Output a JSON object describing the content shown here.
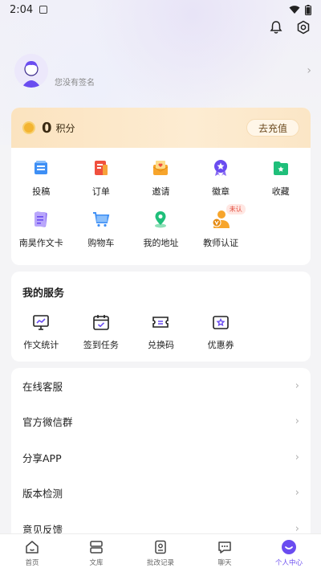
{
  "status_bar": {
    "time": "2:04"
  },
  "profile": {
    "signature": "您没有签名"
  },
  "points": {
    "value": "0",
    "label": "积分",
    "recharge_label": "去充值"
  },
  "features": [
    {
      "label": "投稿",
      "icon": "document-stack-icon"
    },
    {
      "label": "订单",
      "icon": "order-list-icon"
    },
    {
      "label": "邀请",
      "icon": "envelope-icon"
    },
    {
      "label": "徽章",
      "icon": "medal-icon"
    },
    {
      "label": "收藏",
      "icon": "folder-star-icon"
    },
    {
      "label": "南昊作文卡",
      "icon": "essay-card-icon"
    },
    {
      "label": "购物车",
      "icon": "shopping-cart-icon"
    },
    {
      "label": "我的地址",
      "icon": "location-pin-icon"
    },
    {
      "label": "教师认证",
      "icon": "teacher-badge-icon",
      "badge": "未认"
    }
  ],
  "services": {
    "title": "我的服务",
    "items": [
      {
        "label": "作文统计",
        "icon": "chart-monitor-icon"
      },
      {
        "label": "签到任务",
        "icon": "calendar-check-icon"
      },
      {
        "label": "兑换码",
        "icon": "ticket-icon"
      },
      {
        "label": "优惠券",
        "icon": "coupon-star-icon"
      }
    ]
  },
  "menu": [
    "在线客服",
    "官方微信群",
    "分享APP",
    "版本检测",
    "意见反馈"
  ],
  "tabs": [
    {
      "label": "首页",
      "icon": "home-icon"
    },
    {
      "label": "文库",
      "icon": "library-icon"
    },
    {
      "label": "批改记录",
      "icon": "correction-record-icon"
    },
    {
      "label": "聊天",
      "icon": "chat-icon"
    },
    {
      "label": "个人中心",
      "icon": "profile-icon",
      "active": true
    }
  ],
  "colors": {
    "accent": "#6a4cf0",
    "points_gold": "#f3b431"
  }
}
